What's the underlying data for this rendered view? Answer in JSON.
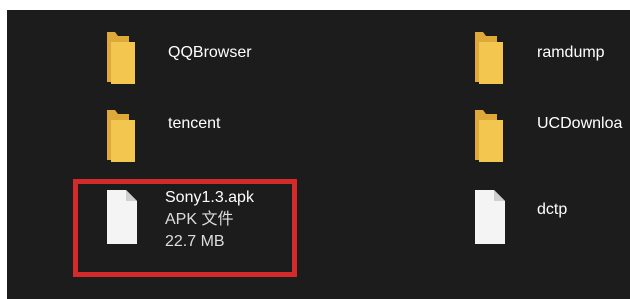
{
  "files": [
    {
      "name": "QQBrowser",
      "type": "folder",
      "icon": "folder-icon"
    },
    {
      "name": "ramdump",
      "type": "folder",
      "icon": "folder-icon"
    },
    {
      "name": "tencent",
      "type": "folder",
      "icon": "folder-icon"
    },
    {
      "name": "UCDownloa",
      "type": "folder",
      "icon": "folder-icon"
    },
    {
      "name": "Sony1.3.apk",
      "type": "APK 文件",
      "size": "22.7 MB",
      "icon": "file-icon"
    },
    {
      "name": "dctp",
      "type": "file",
      "icon": "file-icon"
    }
  ],
  "colors": {
    "background": "#1c1c1c",
    "highlight": "#d42a2a",
    "folder_front": "#f3c74f",
    "folder_back": "#dfa93a",
    "file_page": "#f4f4f4"
  }
}
